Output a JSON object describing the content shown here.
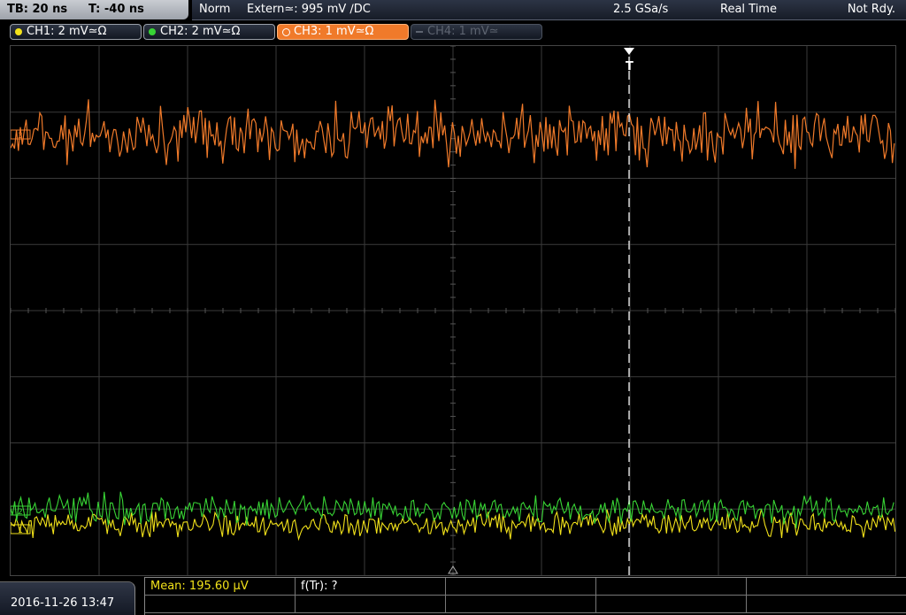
{
  "topbar": {
    "timebase": "TB: 20 ns",
    "trigger_time": "T: -40 ns",
    "acq_mode": "Norm",
    "trigger_source": "Extern≃: 995 mV ∕DC",
    "sample_rate": "2.5 GSa/s",
    "sampling_mode": "Real Time",
    "run_state": "Not Rdy."
  },
  "channels": [
    {
      "label": "CH1: 2 mV≃Ω",
      "color": "#f2e21a",
      "active": true
    },
    {
      "label": "CH2: 2 mV≃Ω",
      "color": "#38d435",
      "active": true
    },
    {
      "label": "CH3: 1 mV≃Ω",
      "color": "#f07a2a",
      "active": true,
      "selected": true
    },
    {
      "label": "CH4: 1 mV≃",
      "color": "#5d6470",
      "active": false
    }
  ],
  "screen": {
    "trigger_marker": "T",
    "ch3_marker": "3",
    "ch2_marker": "2",
    "ch1_marker": "1"
  },
  "bottombar": {
    "datetime": "2016-11-26 13:47",
    "measurement_1": "Mean: 195.60 µV",
    "measurement_2": "f(Tr): ?"
  },
  "colors": {
    "ch1": "#f2e21a",
    "ch2": "#38d435",
    "ch3": "#f07a2a",
    "grid": "#3a3a3a",
    "measurement_text": "#f2e21a"
  }
}
